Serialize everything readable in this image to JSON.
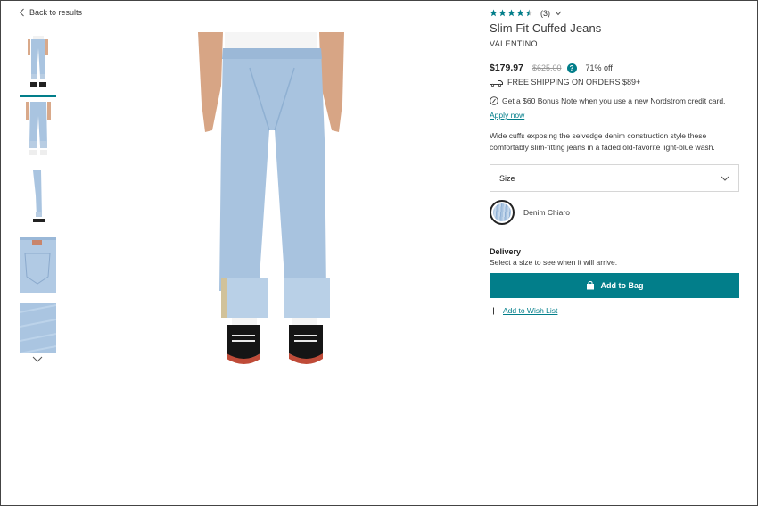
{
  "nav": {
    "back_label": "Back to results"
  },
  "thumbnails": [
    {
      "icon": "jeans-front-thumbnail",
      "selected": true
    },
    {
      "icon": "jeans-front-closeup-thumbnail",
      "selected": false
    },
    {
      "icon": "jeans-side-thumbnail",
      "selected": false
    },
    {
      "icon": "jeans-back-pocket-thumbnail",
      "selected": false
    },
    {
      "icon": "denim-fabric-thumbnail",
      "selected": false
    }
  ],
  "product": {
    "rating_count": "(3)",
    "rating_value": 4.5,
    "title": "Slim Fit Cuffed Jeans",
    "brand": "VALENTINO",
    "price": "$179.97",
    "original_price": "$625.00",
    "discount": "71% off",
    "help_glyph": "?",
    "shipping": "FREE SHIPPING ON ORDERS $89+",
    "credit_note": "Get a $60 Bonus Note when you use a new Nordstrom credit card.",
    "apply_label": "Apply now",
    "description": "Wide cuffs exposing the selvedge denim construction style these comfortably slim-fitting jeans in a faded old-favorite light-blue wash.",
    "size_label": "Size",
    "color_name": "Denim Chiaro",
    "delivery_title": "Delivery",
    "delivery_sub": "Select a size to see when it will arrive.",
    "add_to_bag": "Add to Bag",
    "wish_list": "Add to Wish List"
  },
  "colors": {
    "accent": "#027e8a",
    "text": "#393939",
    "denim": "#a9c4e0"
  }
}
